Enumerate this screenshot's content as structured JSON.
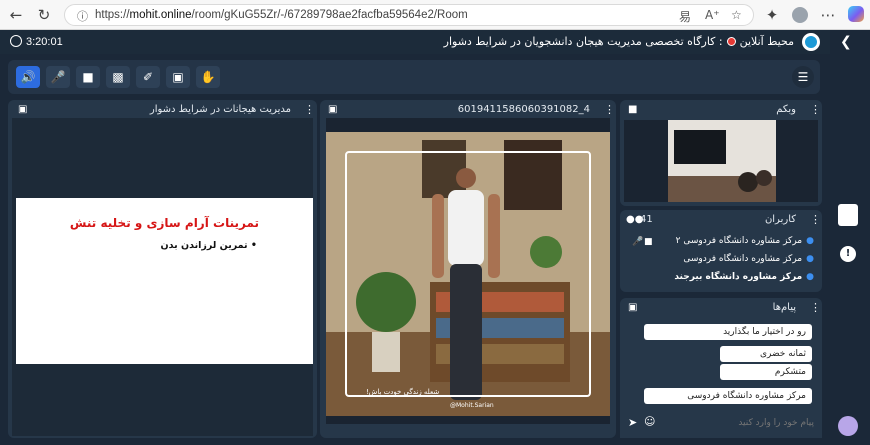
{
  "browser": {
    "url_prefix": "https://",
    "url_host": "mohit.online",
    "url_path": "/room/gKuG55Zr/-/67289798ae2facfba59564e2/Room"
  },
  "header": {
    "timer": "3:20:01",
    "room_label": "محیط آنلاین",
    "room_name": "کارگاه تخصصی مدیریت هیجان دانشجویان در شرایط دشوار"
  },
  "panels": {
    "presentation": {
      "title": "مدیریت هیجانات در شرایط دشوار",
      "slide_title": "تمرینات آرام سازی و تخلیه تنش",
      "slide_bullet": "• تمرین لرزاندن بدن"
    },
    "video": {
      "title": "6019411586060391082_4",
      "overlay_caption": "شعله زندگی خودت باش!",
      "overlay_handle": "@Mohit.Sarian"
    },
    "webcam": {
      "title": "وبکم"
    },
    "users": {
      "title": "کاربران",
      "count": "41",
      "items": [
        {
          "name": "مرکز مشاوره دانشگاه فردوسی ۲"
        },
        {
          "name": "مرکز مشاوره دانشگاه فردوسی"
        },
        {
          "name": "مرکز مشاوره دانشگاه بیرجند"
        }
      ]
    },
    "messages": {
      "title": "پیام‌ها",
      "items": [
        {
          "text": "رو در اختیار ما بگذارید"
        },
        {
          "text": "ثمانه خضری"
        },
        {
          "text": "متشکرم"
        },
        {
          "text": "مرکز مشاوره دانشگاه فردوسی"
        }
      ],
      "input_placeholder": "پیام خود را وارد کنید"
    }
  },
  "colors": {
    "app_bg": "#1b2838",
    "panel_bg": "#263749",
    "accent": "#2d6cdf",
    "live": "#e53935",
    "slide_title": "#d61515"
  }
}
